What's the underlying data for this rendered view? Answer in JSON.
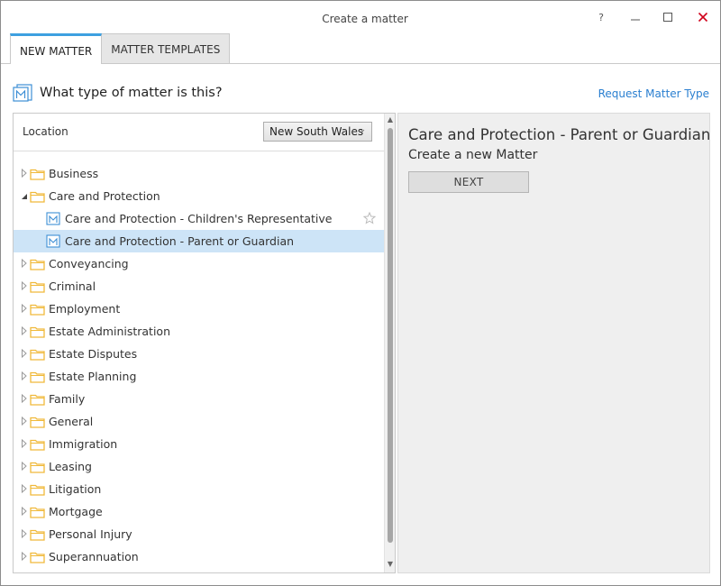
{
  "window": {
    "title": "Create a matter",
    "help_glyph": "?"
  },
  "tabs": [
    {
      "label": "NEW MATTER",
      "active": true
    },
    {
      "label": "MATTER TEMPLATES",
      "active": false
    }
  ],
  "heading": {
    "question": "What type of matter is this?",
    "request_link": "Request Matter Type"
  },
  "location": {
    "label": "Location",
    "selected": "New South Wales"
  },
  "tree": {
    "care_and_protection": "Care and Protection",
    "children": [
      {
        "label": "Care and Protection - Children's Representative",
        "selected": false
      },
      {
        "label": "Care and Protection - Parent or Guardian",
        "selected": true
      }
    ],
    "folders_before": [
      "Business"
    ],
    "folders_after": [
      "Conveyancing",
      "Criminal",
      "Employment",
      "Estate Administration",
      "Estate Disputes",
      "Estate Planning",
      "Family",
      "General",
      "Immigration",
      "Leasing",
      "Litigation",
      "Mortgage",
      "Personal Injury",
      "Superannuation"
    ]
  },
  "detail": {
    "title": "Care and Protection - Parent or Guardian",
    "subtitle": "Create a new Matter",
    "next_label": "NEXT"
  },
  "colors": {
    "accent": "#3ea0e0",
    "link": "#2a7fd0",
    "folder": "#f0b93a",
    "selected_row": "#cde4f7",
    "close": "#d0021b"
  },
  "icons": {
    "folder": "folder-icon",
    "matter": "matter-document-icon",
    "star": "star-outline-icon"
  }
}
